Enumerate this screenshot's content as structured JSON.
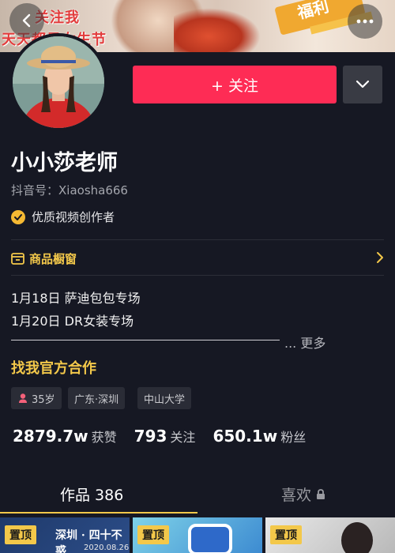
{
  "banner": {
    "line1": "关注我",
    "line2": "天天都是女生节",
    "tag": "福利"
  },
  "header": {
    "back_icon": "chevron-left-icon",
    "more_icon": "more-horizontal-icon"
  },
  "profile": {
    "follow_label": "+ 关注",
    "dropdown_icon": "chevron-down-icon",
    "name": "小小莎老师",
    "douyin_id": "抖音号：Xiaosha666",
    "verify_label": "优质视频创作者",
    "verify_color": "#f5b933"
  },
  "shop": {
    "label": "商品橱窗",
    "icon": "shop-window-icon"
  },
  "bio": {
    "line1": "1月18日 萨迪包包专场",
    "line2": "1月20日 DR女装专场",
    "more": "... 更多",
    "cooperate": "找我官方合作"
  },
  "tags": [
    {
      "label": "35岁",
      "icon": "female-icon"
    },
    {
      "label": "广东·深圳"
    },
    {
      "label": "中山大学"
    }
  ],
  "stats": [
    {
      "num": "2879.7w",
      "label": "获赞"
    },
    {
      "num": "793",
      "label": "关注"
    },
    {
      "num": "650.1w",
      "label": "粉丝"
    }
  ],
  "tabs": {
    "works": "作品 386",
    "likes": "喜欢",
    "lock_icon": "lock-icon"
  },
  "grid": [
    {
      "pin": "置顶",
      "title": "深圳 · 四十不惑",
      "date": "2020.08.26"
    },
    {
      "pin": "置顶"
    },
    {
      "pin": "置顶"
    }
  ],
  "colors": {
    "accent": "#fe2c55",
    "gold": "#f3c84a",
    "background": "#161823"
  }
}
